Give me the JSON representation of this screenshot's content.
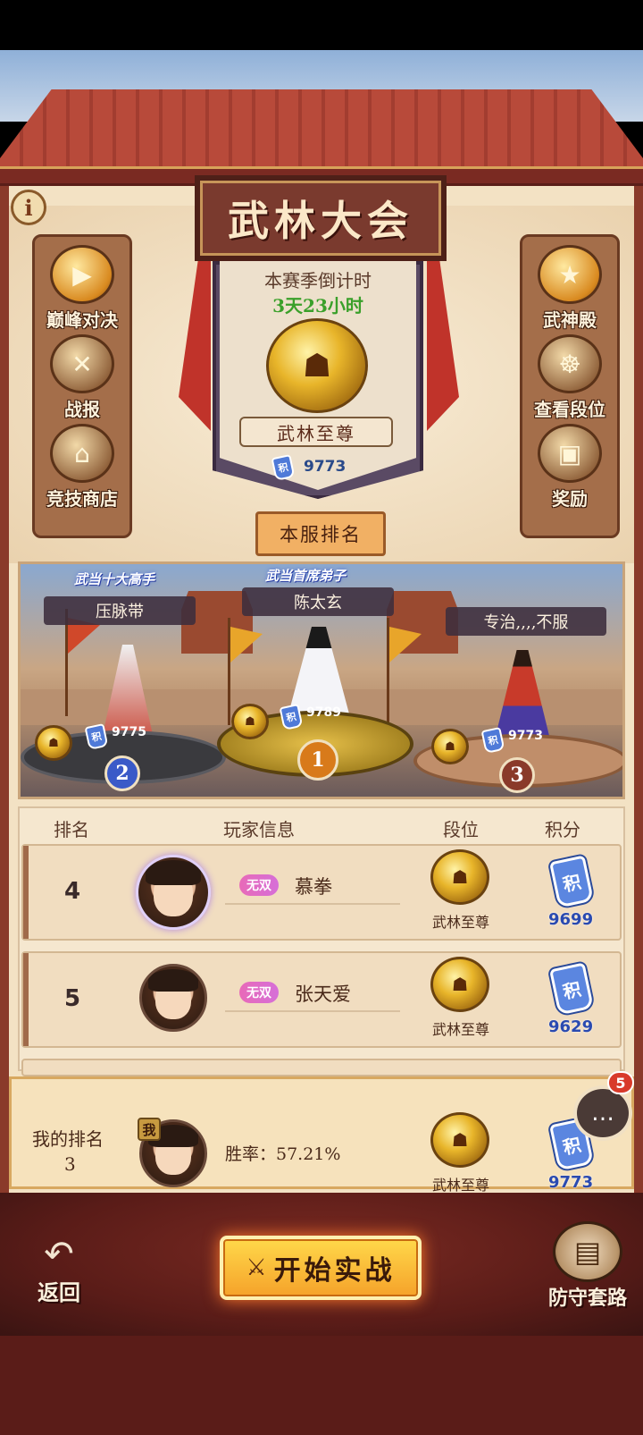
{
  "header": {
    "title": "武林大会"
  },
  "season": {
    "label": "本赛季倒计时",
    "countdown": "3天23小时",
    "tier": "武林至尊",
    "score": "9773"
  },
  "server_rank_button": "本服排名",
  "left_menu": [
    {
      "label": "巅峰对决",
      "icon": "play-icon"
    },
    {
      "label": "战报",
      "icon": "battle-report-icon"
    },
    {
      "label": "竞技商店",
      "icon": "shop-icon"
    }
  ],
  "right_menu": [
    {
      "label": "武神殿",
      "icon": "hall-icon"
    },
    {
      "label": "查看段位",
      "icon": "dragon-icon"
    },
    {
      "label": "奖励",
      "icon": "chest-icon"
    }
  ],
  "podium": {
    "first": {
      "title": "武当首席弟子",
      "name": "陈太玄",
      "score": "9789",
      "rank": "1"
    },
    "second": {
      "title": "武当十大高手",
      "name": "压脉带",
      "score": "9775",
      "rank": "2"
    },
    "third": {
      "name": "专治,,,,不服",
      "score": "9773",
      "rank": "3"
    }
  },
  "table": {
    "headers": {
      "rank": "排名",
      "player": "玩家信息",
      "tier": "段位",
      "score": "积分"
    },
    "rows": [
      {
        "rank": "4",
        "badge": "无双",
        "name": "慕拳",
        "tier": "武林至尊",
        "score": "9699"
      },
      {
        "rank": "5",
        "badge": "无双",
        "name": "张天爱",
        "tier": "武林至尊",
        "score": "9629"
      }
    ]
  },
  "score_icon_char": "积",
  "my_rank": {
    "label": "我的排名",
    "rank": "3",
    "badge": "我",
    "winrate": "胜率：57.21%",
    "tier": "武林至尊",
    "score": "9773"
  },
  "chat": {
    "unread": "5"
  },
  "bottom": {
    "back": "返回",
    "start": "开始实战",
    "defense": "防守套路"
  },
  "colors": {
    "accent_gold": "#f5a22a",
    "panel": "#f3e2c4",
    "score_blue": "#2a4ab0",
    "countdown_green": "#3aa02a"
  }
}
